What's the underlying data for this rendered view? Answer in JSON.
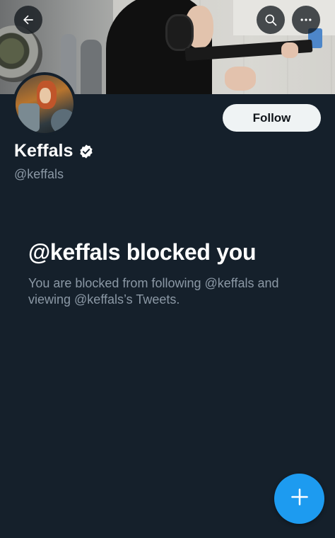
{
  "header": {
    "back_icon": "arrow-left-icon",
    "search_icon": "search-icon",
    "more_icon": "more-horizontal-icon"
  },
  "profile": {
    "display_name": "Keffals",
    "handle": "@keffals",
    "verified": true,
    "follow_label": "Follow"
  },
  "blocked": {
    "title": "@keffals blocked you",
    "description": "You are blocked from following @keffals and viewing @keffals’s Tweets."
  },
  "fab": {
    "icon": "plus-icon"
  },
  "colors": {
    "background": "#15202b",
    "accent": "#1d9bf0",
    "secondary_text": "#8b98a5",
    "follow_button": "#eff3f4"
  }
}
